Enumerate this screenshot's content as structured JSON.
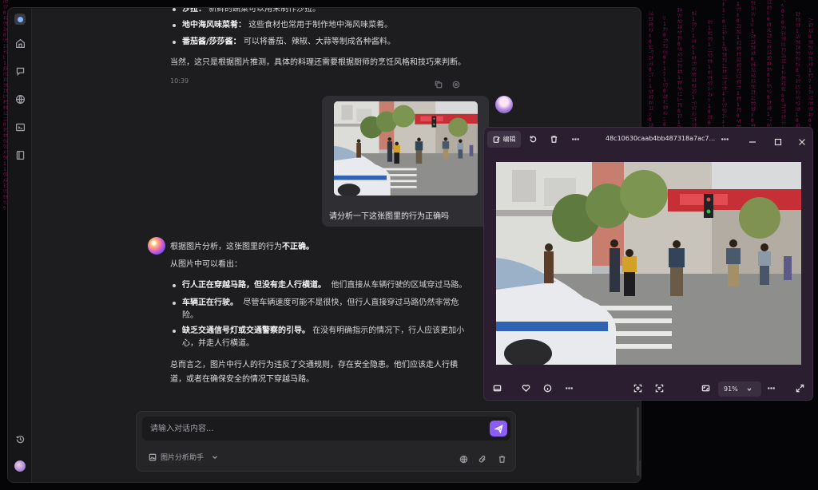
{
  "chat": {
    "prev_bullets": [
      {
        "bold": "沙拉：",
        "text": "新鲜的蔬菜可以用来制作沙拉。"
      },
      {
        "bold": "地中海风味菜肴：",
        "text": "这些食材也常用于制作地中海风味菜肴。"
      },
      {
        "bold": "番茄酱/莎莎酱：",
        "text": "可以将番茄、辣椒、大蒜等制成各种酱料。"
      }
    ],
    "prev_conclusion": "当然，这只是根据图片推测，具体的料理还需要根据厨师的烹饪风格和技巧来判断。",
    "prev_time": "10:39",
    "user_message": "请分析一下这张图里的行为正确吗",
    "answer_intro_prefix": "根据图片分析，这张图里的行为",
    "answer_intro_bold": "不正确。",
    "answer_lead": "从图片中可以看出：",
    "answer_bullets": [
      {
        "bold": "行人正在穿越马路，但没有走人行横道。",
        "line1": "他们直接从车辆行驶的区域穿过马路。",
        "line2": ""
      },
      {
        "bold": "车辆正在行驶。",
        "line1": "尽管车辆速度可能不是很快，但行人直接穿过马路仍然非常危",
        "line2": "险。"
      },
      {
        "bold": "缺乏交通信号灯或交通警察的引导。",
        "line1": "在没有明确指示的情况下，行人应该更加小",
        "line2": "心，并走人行横道。"
      }
    ],
    "answer_summary_line1": "总而言之，图片中行人的行为违反了交通规则，存在安全隐患。他们应该走人行横",
    "answer_summary_line2": "道，或者在确保安全的情况下穿越马路。",
    "input_placeholder": "请输入对话内容...",
    "assistant_name": "图片分析助手"
  },
  "viewer": {
    "edit_label": "编辑",
    "file_name": "48c10630caab4bb487318a7ac7...",
    "zoom": "91%"
  },
  "colors": {
    "accent": "#8b5cf6",
    "app_bg": "#1d1d1f",
    "viewer_bg": "#2b1e30",
    "matrix": "#c21a7a"
  }
}
